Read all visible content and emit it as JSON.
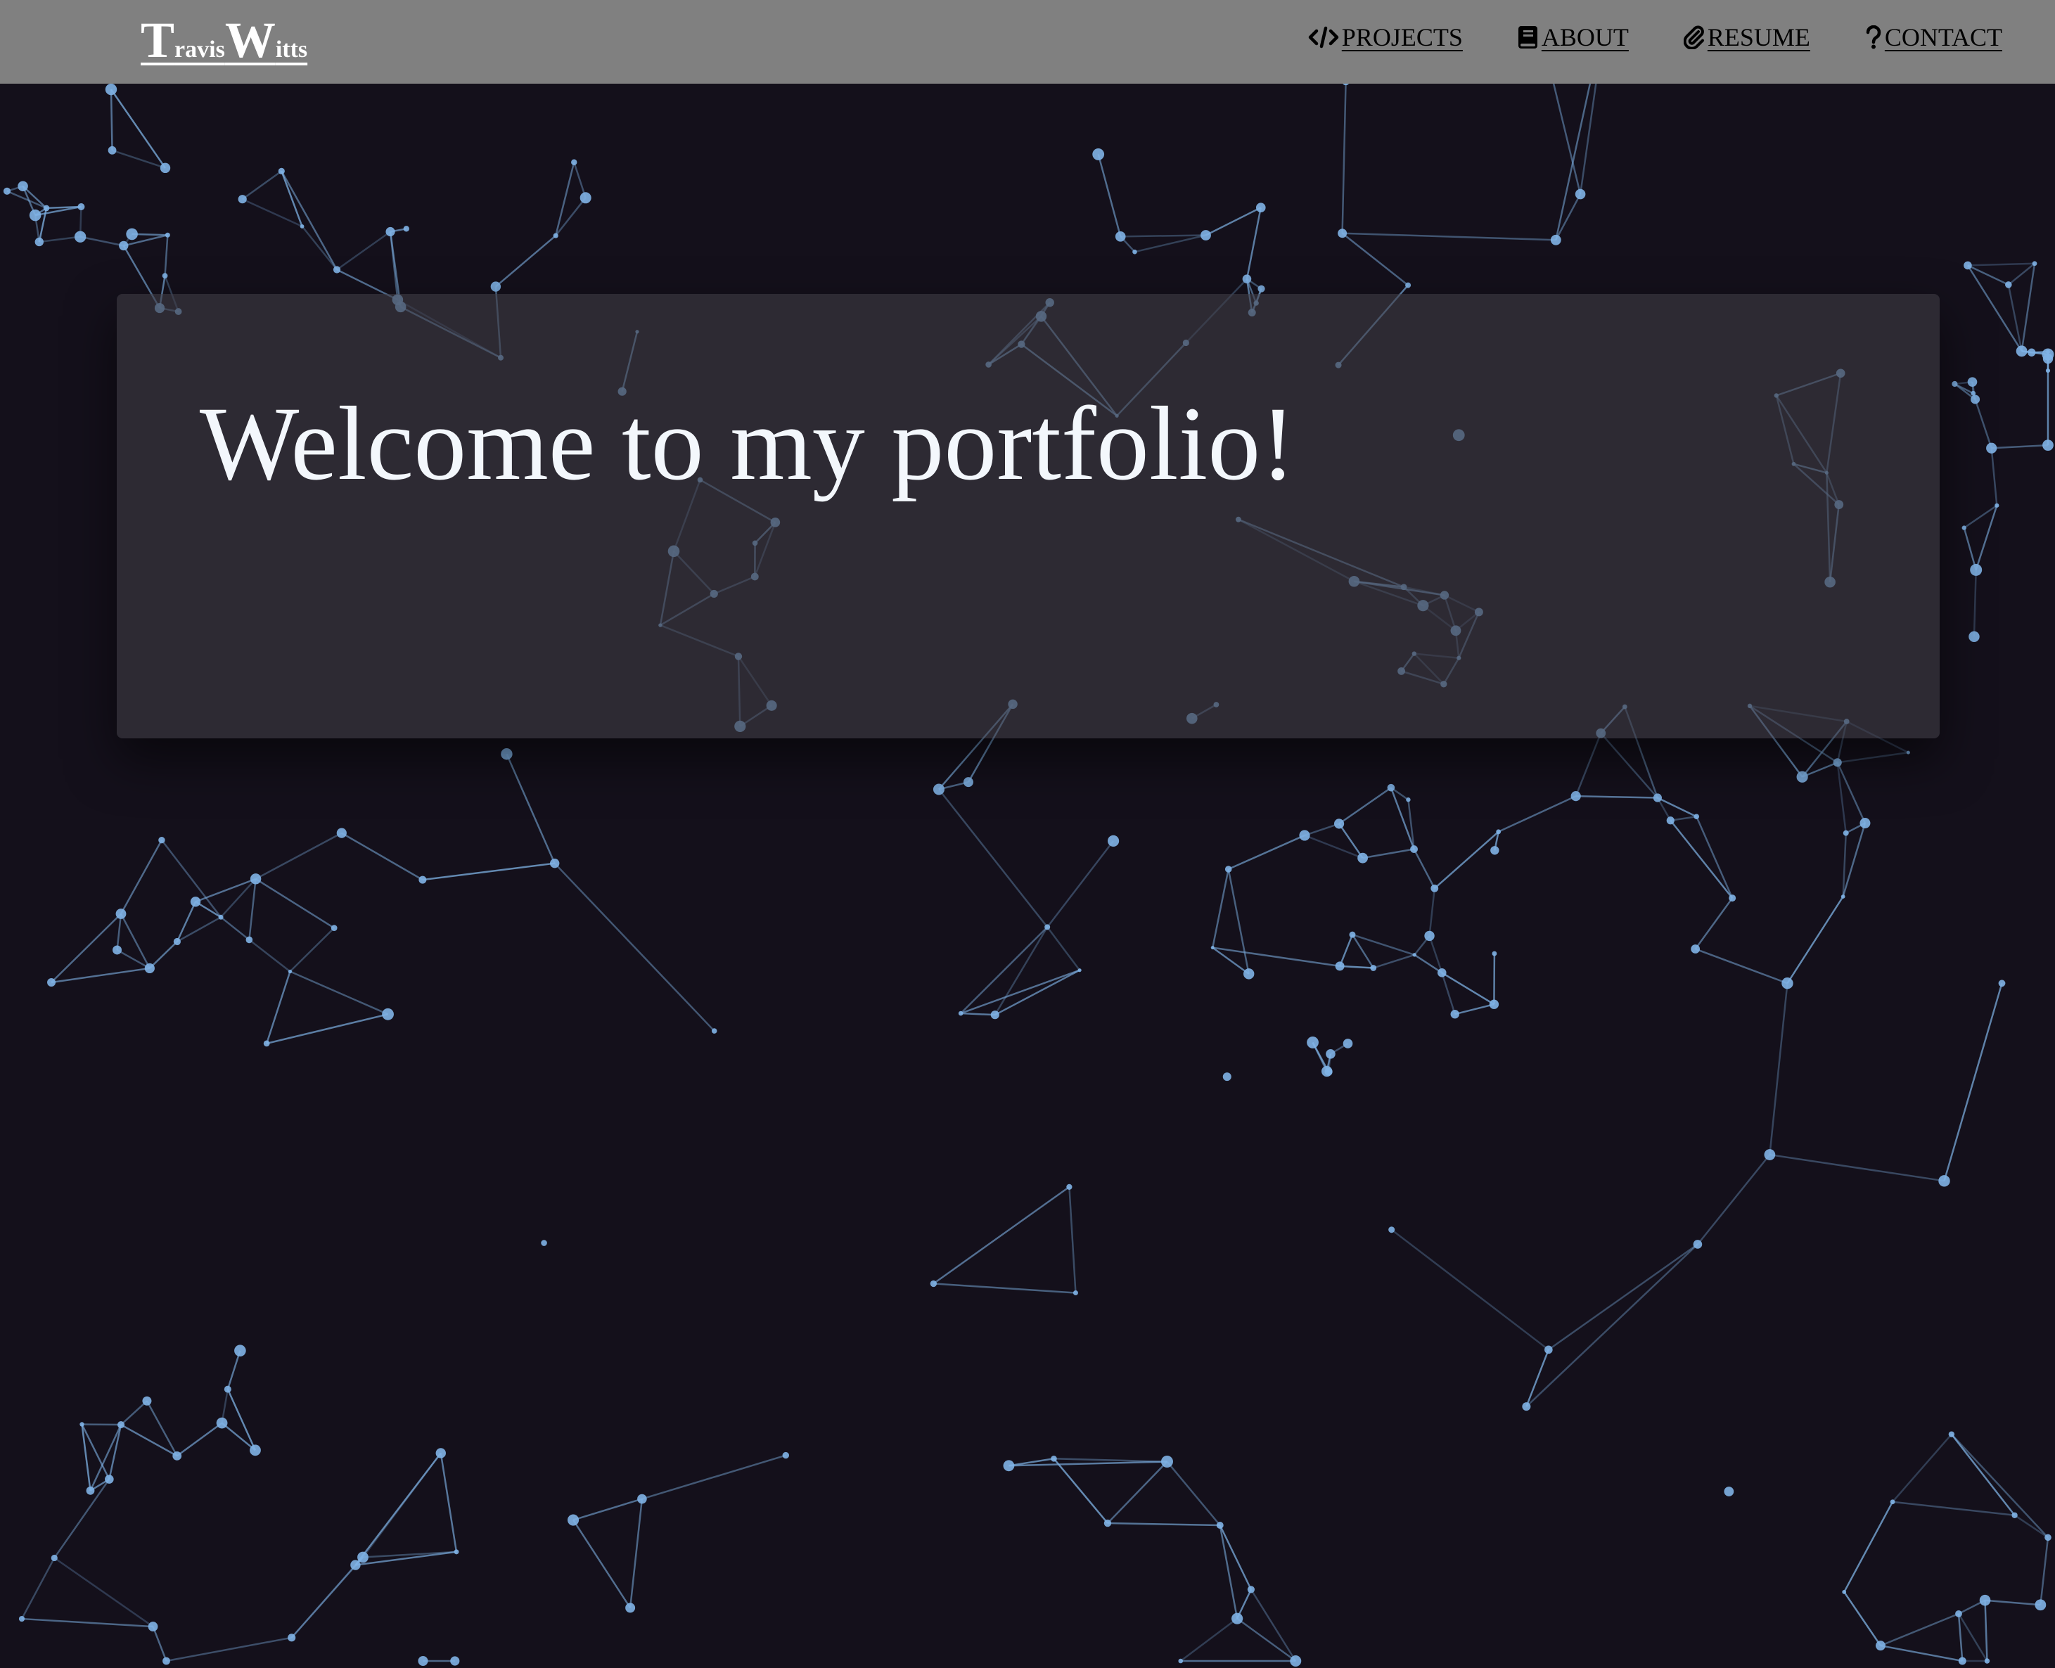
{
  "brand": {
    "first_initial": "T",
    "first_rest": "ravis",
    "last_initial": "W",
    "last_rest": "itts"
  },
  "nav": {
    "items": [
      {
        "label": " PROJECTS",
        "icon": "code-icon"
      },
      {
        "label": "ABOUT",
        "icon": "book-icon"
      },
      {
        "label": " RESUME",
        "icon": "paperclip-icon"
      },
      {
        "label": " CONTACT",
        "icon": "question-icon"
      }
    ]
  },
  "hero": {
    "title": "Welcome to my portfolio!"
  },
  "colors": {
    "background": "#14101b",
    "navbar": "#808080",
    "network_line": "#7fb3e6",
    "card": "rgba(62,58,66,0.62)",
    "title": "#f3f7fc"
  }
}
